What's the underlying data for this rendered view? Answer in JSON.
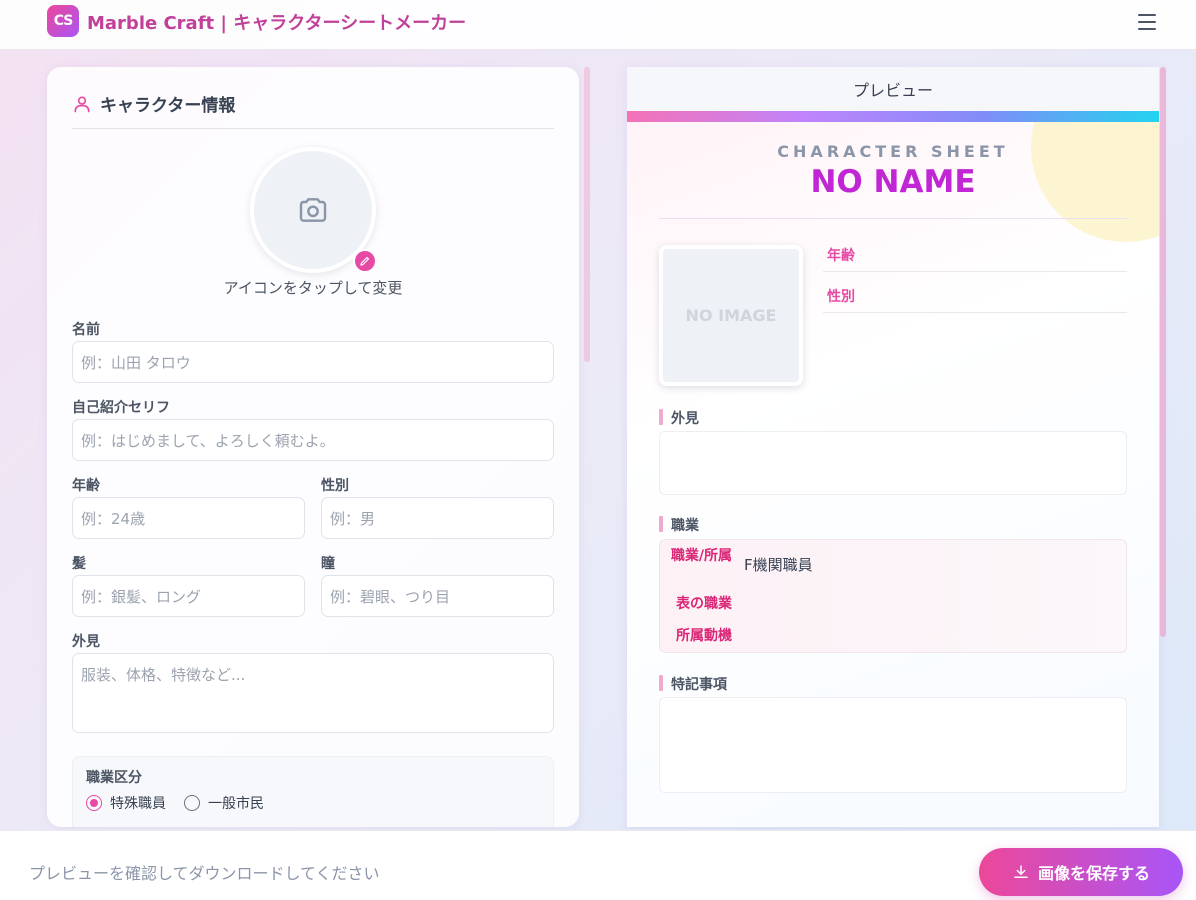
{
  "header": {
    "logo_text": "CS",
    "title": "Marble Craft | キャラクターシートメーカー",
    "menu_icon": "hamburger-icon"
  },
  "form": {
    "section_title": "キャラクター情報",
    "avatar_caption": "アイコンをタップして変更",
    "name": {
      "label": "名前",
      "placeholder": "例：山田 タロウ"
    },
    "intro": {
      "label": "自己紹介セリフ",
      "placeholder": "例：はじめまして、よろしく頼むよ。"
    },
    "age": {
      "label": "年齢",
      "placeholder": "例：24歳"
    },
    "gender": {
      "label": "性別",
      "placeholder": "例：男"
    },
    "hair": {
      "label": "髪",
      "placeholder": "例：銀髪、ロング"
    },
    "eyes": {
      "label": "瞳",
      "placeholder": "例：碧眼、つり目"
    },
    "appearance": {
      "label": "外見",
      "placeholder": "服装、体格、特徴など..."
    },
    "job_category": {
      "label": "職業区分",
      "options": [
        "特殊職員",
        "一般市民"
      ],
      "selected": "特殊職員"
    }
  },
  "preview": {
    "header": "プレビュー",
    "kicker": "CHARACTER SHEET",
    "name": "NO NAME",
    "photo_placeholder": "NO IMAGE",
    "props": [
      "年齢",
      "性別"
    ],
    "sections": {
      "appearance": "外見",
      "job": "職業",
      "notes": "特記事項"
    },
    "job_rows": [
      {
        "key": "職業/所属",
        "value": "F機関職員"
      },
      {
        "key": "表の職業",
        "value": ""
      },
      {
        "key": "所属動機",
        "value": ""
      }
    ]
  },
  "footer": {
    "message": "プレビューを確認してダウンロードしてください",
    "save_label": "画像を保存する"
  }
}
